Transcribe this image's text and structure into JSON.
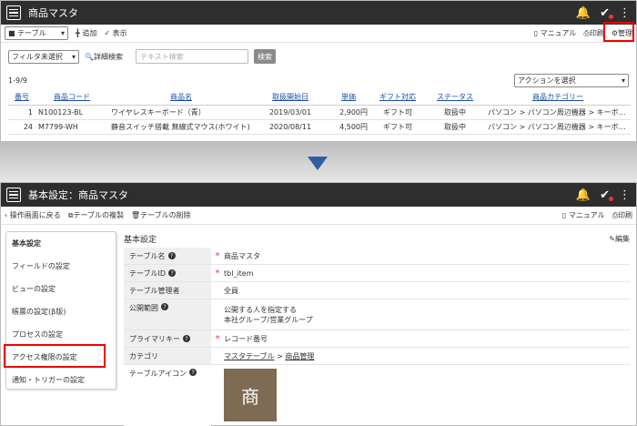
{
  "top": {
    "title": "商品マスタ",
    "toolbar": {
      "view_select": "■ テーブル",
      "add": "╋ 追加",
      "display": "✓ 表示",
      "manual": "マニュアル",
      "print": "印刷",
      "manage": "管理"
    },
    "filter": {
      "select": "フィルタ未選択",
      "detail_search": "詳細検索",
      "text_placeholder": "テキスト検索",
      "search_btn": "検索"
    },
    "count": "1-9/9",
    "action_select": "アクションを選択",
    "table": {
      "headers": [
        "番号",
        "商品コード",
        "商品名",
        "取扱開始日",
        "単価",
        "ギフト対応",
        "ステータス",
        "商品カテゴリー"
      ],
      "rows": [
        [
          "1",
          "N100123-BL",
          "ワイヤレスキーボード（青）",
          "2019/03/01",
          "2,900円",
          "ギフト可",
          "取扱中",
          "パソコン > パソコン周辺機器 > キーボ…"
        ],
        [
          "24",
          "M7799-WH",
          "静音スイッチ搭載 無線式マウス(ホワイト)",
          "2020/08/11",
          "4,500円",
          "ギフト可",
          "取扱中",
          "パソコン > パソコン周辺機器 > キーボ…"
        ]
      ]
    }
  },
  "bottom": {
    "title": "基本設定：商品マスタ",
    "toolbar": {
      "back": "操作画面に戻る",
      "copy": "テーブルの複製",
      "delete": "テーブルの削除",
      "manual": "マニュアル",
      "print": "印刷"
    },
    "sidebar": [
      "基本設定",
      "フィールドの設定",
      "ビューの設定",
      "帳票の設定(β版)",
      "プロセスの設定",
      "アクセス権限の設定",
      "通知・トリガーの設定"
    ],
    "panel": {
      "heading": "基本設定",
      "edit": "編集",
      "fields": [
        {
          "label": "テーブル名",
          "help": true,
          "required": true,
          "value": "商品マスタ"
        },
        {
          "label": "テーブルID",
          "help": true,
          "required": true,
          "value": "tbl_item"
        },
        {
          "label": "テーブル管理者",
          "help": false,
          "required": false,
          "value": "全員"
        },
        {
          "label": "公開範囲",
          "help": true,
          "required": false,
          "value": "公開する人を指定する",
          "value2": "本社グループ/営業グループ"
        },
        {
          "label": "プライマリキー",
          "help": true,
          "required": true,
          "value": "レコード番号"
        },
        {
          "label": "カテゴリ",
          "help": false,
          "required": false,
          "value": "マスタテーブル",
          "sep": ">",
          "value2": "商品管理"
        },
        {
          "label": "テーブルアイコン",
          "help": true,
          "required": false,
          "value": "商"
        }
      ]
    }
  }
}
